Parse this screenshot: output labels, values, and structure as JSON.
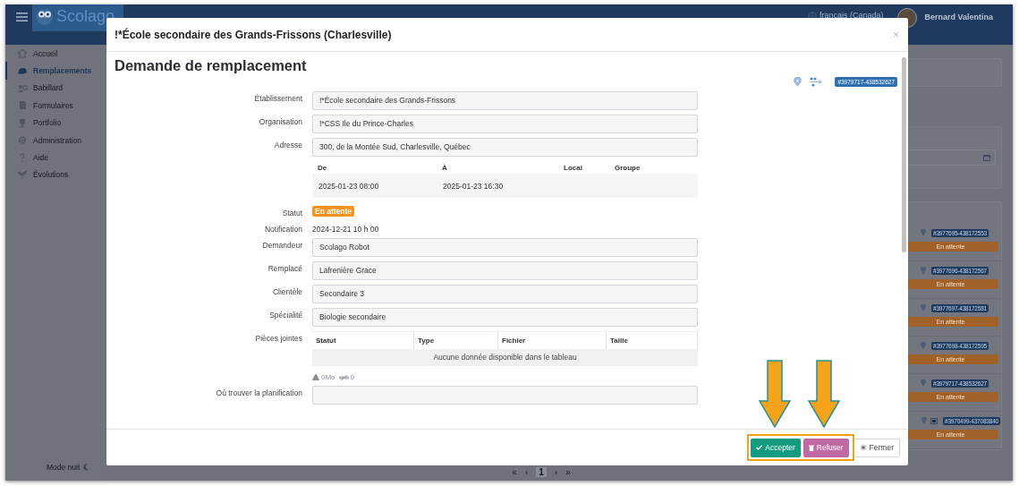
{
  "topbar": {
    "logo": "Scolago",
    "language": "français (Canada)",
    "user": "Bernard Valentina"
  },
  "sidebar": {
    "items": [
      {
        "label": "Accueil",
        "selected": false
      },
      {
        "label": "Remplacements",
        "selected": true
      },
      {
        "label": "Babillard",
        "selected": false
      },
      {
        "label": "Formulaires",
        "selected": false
      },
      {
        "label": "Portfolio",
        "selected": false
      },
      {
        "label": "Administration",
        "selected": false
      },
      {
        "label": "Aide",
        "selected": false
      },
      {
        "label": "Évolutions",
        "selected": false
      }
    ],
    "night_mode": "Mode nuit"
  },
  "background_list": [
    {
      "kind": "editable",
      "reference": "#3977695-438172553",
      "status": "En attente"
    },
    {
      "kind": "editable",
      "reference": "#3977696-438172567",
      "status": "En attente"
    },
    {
      "kind": "editable",
      "reference": "#3977697-438172581",
      "status": "En attente"
    },
    {
      "kind": "editable",
      "reference": "#3977698-438172595",
      "status": "En attente"
    },
    {
      "kind": "editable",
      "reference": "#3979717-438532627",
      "status": "En attente"
    },
    {
      "kind": "image",
      "reference": "#3970499-437083840",
      "status": "En attente"
    }
  ],
  "pagination": {
    "first": "«",
    "previous": "‹",
    "pages": [
      {
        "label": "1",
        "selected": true
      }
    ],
    "next": "›",
    "last": "»"
  },
  "modal": {
    "title": "!*École secondaire des Grands-Frissons (Charlesville)",
    "close": "×",
    "heading": "Demande de remplacement",
    "reference": "#3979717-438532627",
    "rows": [
      {
        "kind": "field",
        "label": "Établissement",
        "value": "!*École secondaire des Grands-Frissons"
      },
      {
        "kind": "field",
        "label": "Organisation",
        "value": "!*CSS Ile du Prince-Charles"
      },
      {
        "kind": "field",
        "label": "Adresse",
        "value": "300, de la Montée Sud, Charlesville, Québec"
      },
      {
        "kind": "schedule",
        "columns": [
          "De",
          "À",
          "Local",
          "Groupe"
        ],
        "rows": [
          [
            "2025-01-23 08:00",
            "2025-01-23 16:30"
          ]
        ]
      },
      {
        "kind": "status",
        "label": "Statut",
        "value": "En attente"
      },
      {
        "kind": "text",
        "label": "Notification",
        "value": "2024-12-21 10 h 00"
      },
      {
        "kind": "field",
        "label": "Demandeur",
        "value": "Scolago Robot"
      },
      {
        "kind": "field",
        "label": "Remplacé",
        "value": "Lafrenière Grace"
      },
      {
        "kind": "field",
        "label": "Clientèle",
        "value": "Secondaire 3"
      },
      {
        "kind": "field",
        "label": "Spécialité",
        "value": "Biologie secondaire"
      },
      {
        "kind": "attachments",
        "label": "Pièces jointes",
        "columns": [
          "Statut",
          "Type",
          "Fichier",
          "Taille"
        ],
        "empty": "Aucune donnée disponible dans le tableau",
        "size": "0Mo",
        "count": "0"
      },
      {
        "kind": "field",
        "label": "Où trouver la planification"
      }
    ],
    "buttons": [
      {
        "kind": "accept",
        "label": "Accepter"
      },
      {
        "kind": "refuse",
        "label": "Refuser"
      },
      {
        "kind": "close",
        "label": "Fermer"
      }
    ]
  }
}
